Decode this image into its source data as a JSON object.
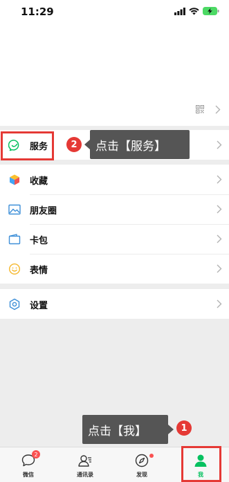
{
  "status": {
    "time": "11:29"
  },
  "menu": {
    "services": {
      "label": "服务",
      "icon": "services-icon"
    },
    "items": [
      {
        "label": "收藏",
        "icon": "favorites-icon"
      },
      {
        "label": "朋友圈",
        "icon": "moments-icon"
      },
      {
        "label": "卡包",
        "icon": "card-wallet-icon"
      },
      {
        "label": "表情",
        "icon": "sticker-icon"
      }
    ],
    "settings": {
      "label": "设置",
      "icon": "gear-icon"
    }
  },
  "callouts": {
    "step2": {
      "number": "2",
      "text": "点击【服务】"
    },
    "step1": {
      "number": "1",
      "text": "点击【我】"
    }
  },
  "tabs": [
    {
      "label": "微信",
      "badge": "2"
    },
    {
      "label": "通讯录"
    },
    {
      "label": "发现"
    },
    {
      "label": "我"
    }
  ],
  "colors": {
    "accent": "#07c160",
    "highlight": "#e53935",
    "callout_bg": "#555555",
    "badge": "#fa5151",
    "page_bg": "#ededed"
  }
}
